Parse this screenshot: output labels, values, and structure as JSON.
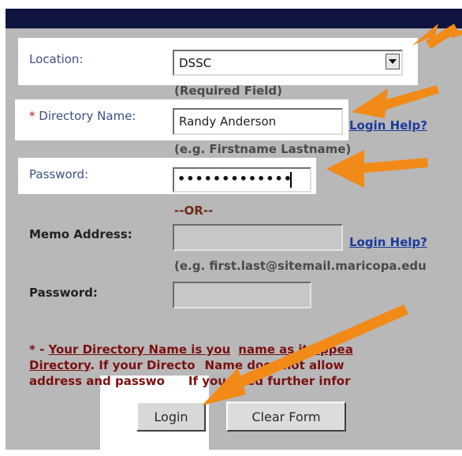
{
  "form": {
    "location_label": "Location:",
    "location_value": "DSSC",
    "required_note": "(Required Field)",
    "directory_asterisk": "*",
    "directory_label": " Directory Name:",
    "directory_value": "Randy Anderson",
    "login_help_1": "Login Help?",
    "directory_example": "(e.g. Firstname Lastname)",
    "password_label": "Password:",
    "password_masked": "•••••••••••••",
    "or_separator": "--OR--",
    "memo_label": "Memo Address:",
    "memo_value": "",
    "login_help_2": "Login Help?",
    "memo_example": "(e.g. first.last@sitemail.maricopa.edu",
    "password2_label": "Password:",
    "password2_value": ""
  },
  "footnote": {
    "line1_prefix": "* - ",
    "line1_link": "Your Directory Name is you",
    "line1_link_rest": "name as it appea",
    "line2_link": "Directory",
    "line2_mid": ". If your Directo",
    "line2_rest": "Name does not allow",
    "line3_a": "address and passwo",
    "line3_b": "If you need further infor"
  },
  "buttons": {
    "login": "Login",
    "clear": "Clear Form"
  },
  "colors": {
    "arrow": "#f28a18",
    "panel": "#b8b8b8",
    "topbar": "#0f1440",
    "label": "#3d4f86",
    "link": "#1c3a9c",
    "required": "#c0141a"
  }
}
